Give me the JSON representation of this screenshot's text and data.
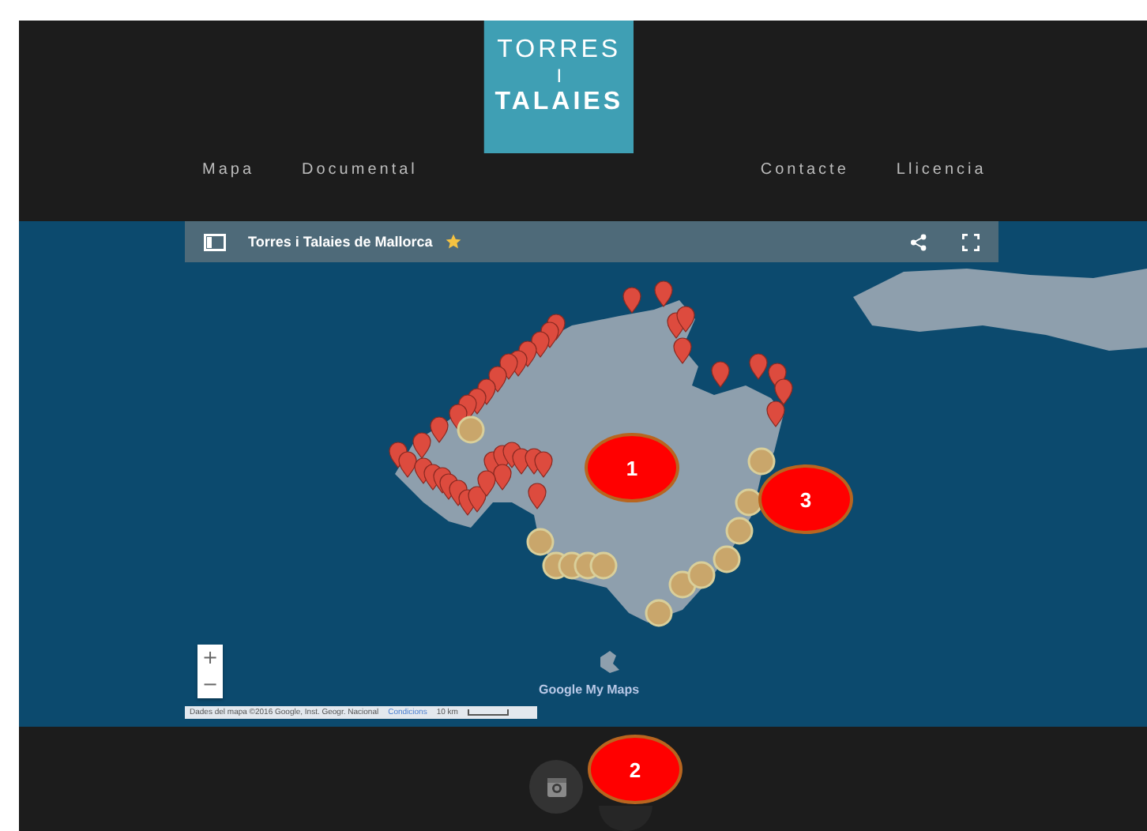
{
  "header": {
    "nav_left": [
      "Mapa",
      "Documental"
    ],
    "logo": {
      "line_1": "TORRES",
      "line_2": "I",
      "line_3": "TALAIES"
    },
    "nav_right": [
      "Contacte",
      "Llicencia"
    ]
  },
  "map": {
    "title": "Torres i Talaies de Mallorca",
    "starred": true,
    "zoom_in": "+",
    "zoom_out": "−",
    "branding": "Google My Maps",
    "attribution": "Dades del mapa ©2016 Google, Inst. Geogr. Nacional",
    "terms_link": "Condicions",
    "scale": "10 km"
  },
  "annotations": [
    {
      "label": "1"
    },
    {
      "label": "2"
    },
    {
      "label": "3"
    }
  ]
}
